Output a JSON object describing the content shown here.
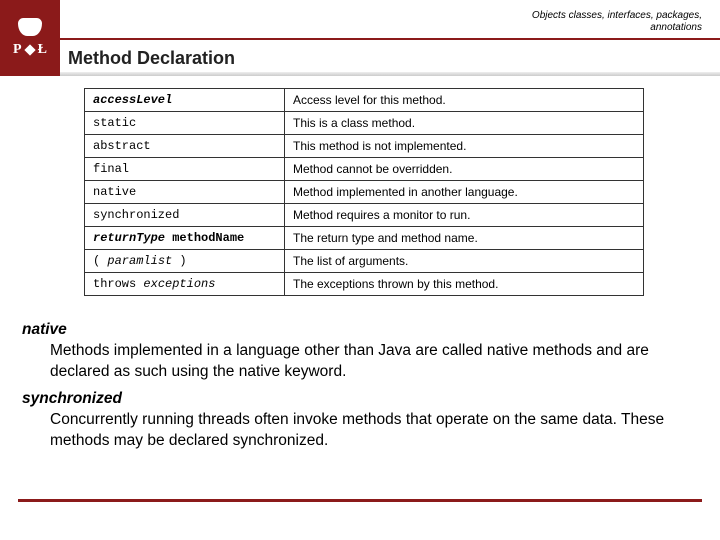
{
  "header": {
    "breadcrumb_line1": "Objects classes, interfaces, packages,",
    "breadcrumb_line2": "annotations",
    "logo_left": "P",
    "logo_right": "Ł",
    "section_title": "Method Declaration"
  },
  "table": {
    "rows": [
      {
        "key_pre": "accessLevel",
        "key_plain": "",
        "key_italic": true,
        "desc": "Access level for this method."
      },
      {
        "key_pre": "static",
        "key_plain": "",
        "key_italic": false,
        "desc": "This is a class method."
      },
      {
        "key_pre": "abstract",
        "key_plain": "",
        "key_italic": false,
        "desc": "This method is not implemented."
      },
      {
        "key_pre": "final",
        "key_plain": "",
        "key_italic": false,
        "desc": "Method cannot be overridden."
      },
      {
        "key_pre": "native",
        "key_plain": "",
        "key_italic": false,
        "desc": "Method implemented in another language."
      },
      {
        "key_pre": "synchronized",
        "key_plain": "",
        "key_italic": false,
        "desc": "Method requires a monitor to run."
      },
      {
        "key_pre": "returnType",
        "key_plain": " methodName",
        "key_italic": true,
        "key_plain_bold": true,
        "desc": "The return type and method name."
      },
      {
        "key_pre": "( ",
        "key_mid": "paramlist",
        "key_post": " )",
        "key_mid_italic": true,
        "desc": "The list of arguments."
      },
      {
        "key_pre": "throws ",
        "key_mid": "exceptions",
        "key_mid_italic": true,
        "desc": "The exceptions thrown by this method."
      }
    ]
  },
  "body": {
    "term1": "native",
    "def1": " Methods implemented in a language other than Java are called native methods and are declared as such using the native keyword.",
    "term2": "synchronized",
    "def2": "Concurrently running threads often invoke methods that operate on the same data. These methods may be declared synchronized."
  }
}
